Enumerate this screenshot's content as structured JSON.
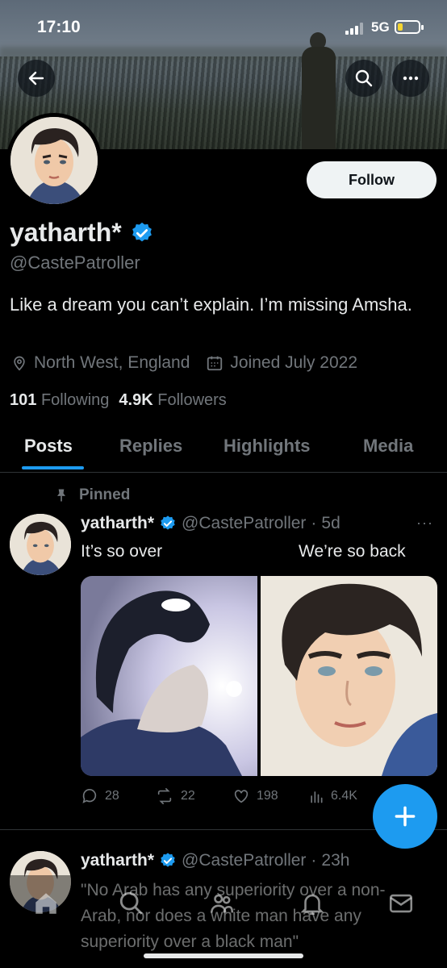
{
  "status_bar": {
    "time": "17:10",
    "network": "5G"
  },
  "profile": {
    "name": "yatharth*",
    "handle": "@CastePatroller",
    "bio": "Like a dream you can’t explain. I’m missing Amsha.",
    "location": "North West, England",
    "joined": "Joined July 2022",
    "following_count": "101",
    "following_label": "Following",
    "followers_count": "4.9K",
    "followers_label": "Followers",
    "follow_label": "Follow",
    "verified_color": "#1d9bf0"
  },
  "tabs": [
    {
      "label": "Posts",
      "active": true
    },
    {
      "label": "Replies",
      "active": false
    },
    {
      "label": "Highlights",
      "active": false
    },
    {
      "label": "Media",
      "active": false
    }
  ],
  "posts": [
    {
      "pinned_label": "Pinned",
      "name": "yatharth*",
      "handle": "@CastePatroller",
      "time": "5d",
      "text_left": "It’s so over",
      "text_right": "We’re so back",
      "replies": "28",
      "reposts": "22",
      "likes": "198",
      "views": "6.4K"
    },
    {
      "name": "yatharth*",
      "handle": "@CastePatroller",
      "time": "23h",
      "text": "\"No Arab has any superiority over a non-Arab, nor does a white man have any superiority over a black man\""
    }
  ],
  "icons": {
    "back": "arrow-left-icon",
    "search": "search-icon",
    "more": "more-icon",
    "compose": "plus-icon"
  },
  "colors": {
    "accent": "#1d9bf0",
    "background": "#000000",
    "text": "#e7e9ea",
    "muted": "#71767b"
  }
}
